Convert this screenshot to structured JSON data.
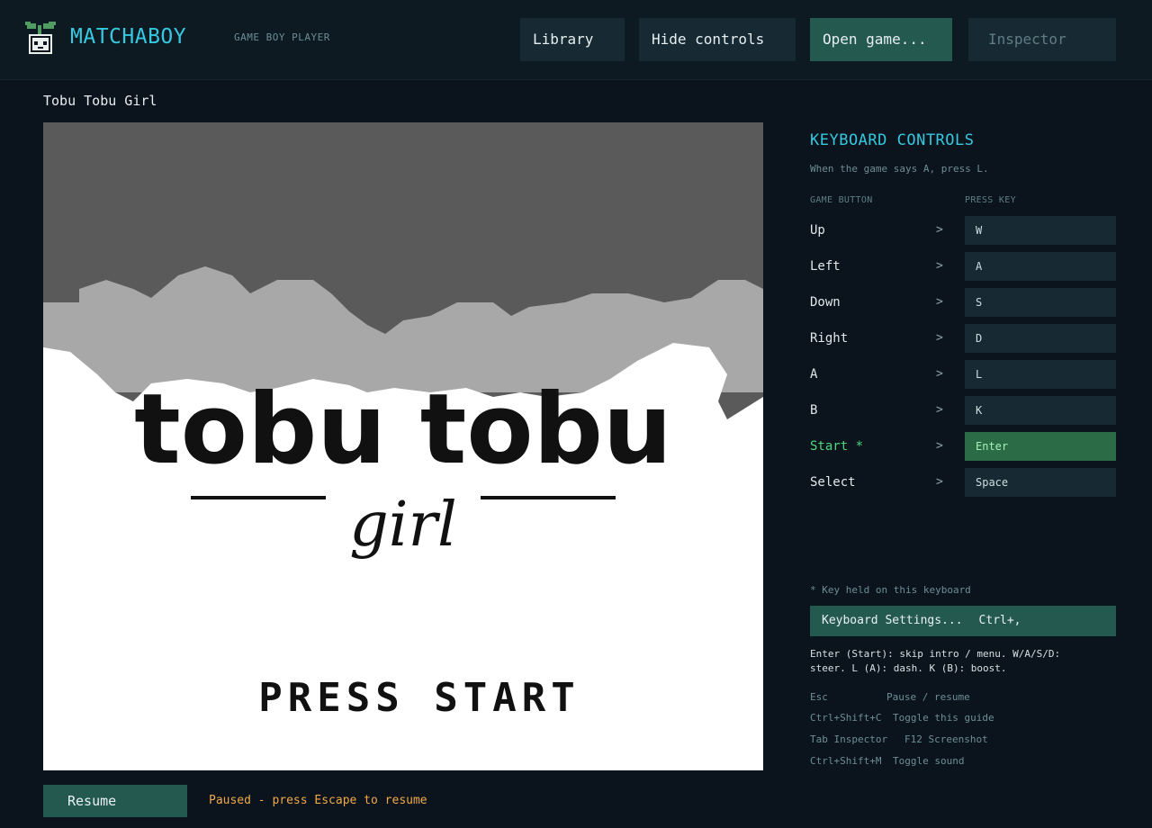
{
  "header": {
    "brand": "MATCHABOY",
    "subtitle": "GAME BOY PLAYER",
    "buttons": {
      "library": "Library",
      "hide_controls": "Hide controls",
      "open_game": "Open game...",
      "inspector": "Inspector"
    }
  },
  "game": {
    "title": "Tobu Tobu Girl",
    "screen": {
      "logo_line1": "tobu tobu",
      "logo_line2": "girl",
      "prompt": "PRESS START"
    },
    "resume_label": "Resume",
    "status": "Paused - press Escape to resume"
  },
  "controls": {
    "title": "KEYBOARD CONTROLS",
    "hint": "When the game says A, press L.",
    "col_game": "GAME BUTTON",
    "col_key": "PRESS KEY",
    "mappings": [
      {
        "button": "Up",
        "key": "W"
      },
      {
        "button": "Left",
        "key": "A"
      },
      {
        "button": "Down",
        "key": "S"
      },
      {
        "button": "Right",
        "key": "D"
      },
      {
        "button": "A",
        "key": "L"
      },
      {
        "button": "B",
        "key": "K"
      },
      {
        "button": "Start *",
        "key": "Enter"
      },
      {
        "button": "Select",
        "key": "Space"
      }
    ],
    "arrow": ">",
    "footnote": "* Key held on this keyboard",
    "settings_label": "Keyboard Settings...",
    "settings_shortcut": "Ctrl+,",
    "help_text": "Enter (Start): skip intro / menu. W/A/S/D: steer. L (A): dash. K (B): boost.",
    "shortcuts": [
      {
        "key": "Esc",
        "desc": "Pause / resume"
      },
      {
        "key": "Ctrl+Shift+C",
        "desc": "Toggle this guide"
      },
      {
        "key": "Tab Inspector",
        "desc": "F12 Screenshot"
      },
      {
        "key": "Ctrl+Shift+M",
        "desc": "Toggle sound"
      }
    ]
  },
  "colors": {
    "accent": "#35c8e0",
    "primary_button": "#24594f",
    "held_key": "#2b6b45",
    "held_label": "#4fd67c",
    "paused_status": "#f0a94a"
  }
}
